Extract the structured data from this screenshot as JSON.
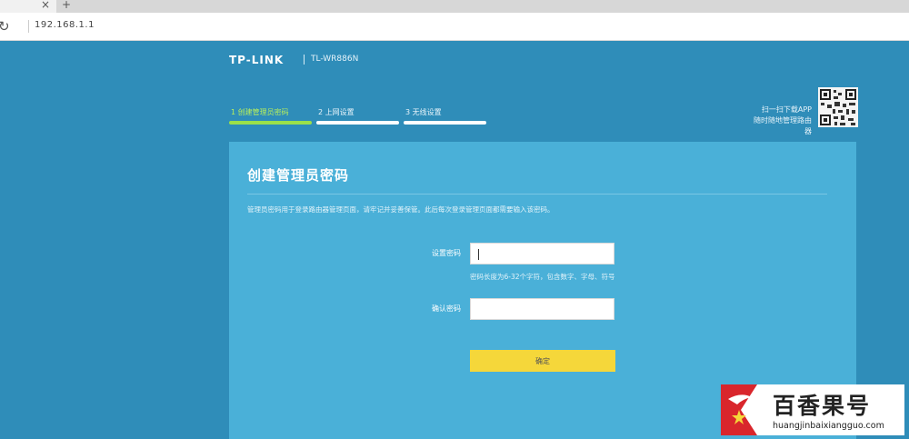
{
  "browser": {
    "tab_close_glyph": "×",
    "new_tab_glyph": "+",
    "url": "192.168.1.1"
  },
  "header": {
    "brand": "TP-LINK",
    "model": "TL-WR886N"
  },
  "steps": [
    {
      "label": "1 创建管理员密码",
      "active": true
    },
    {
      "label": "2 上网设置",
      "active": false
    },
    {
      "label": "3 无线设置",
      "active": false
    }
  ],
  "qr": {
    "line1": "扫一扫下载APP",
    "line2": "随时随地管理路由器"
  },
  "card": {
    "title": "创建管理员密码",
    "description": "管理员密码用于登录路由器管理页面，请牢记并妥善保管。此后每次登录管理页面都需要输入该密码。",
    "password_label": "设置密码",
    "password_hint": "密码长度为6-32个字符，包含数字、字母、符号",
    "confirm_label": "确认密码",
    "submit_label": "确定"
  },
  "watermark": {
    "name": "百香果号",
    "url": "huangjinbaixiangguo.com"
  },
  "colors": {
    "page_bg": "#2f8db9",
    "card_bg": "#4ab0d8",
    "active_step": "#9be04a",
    "submit_bg": "#f5d73a"
  }
}
